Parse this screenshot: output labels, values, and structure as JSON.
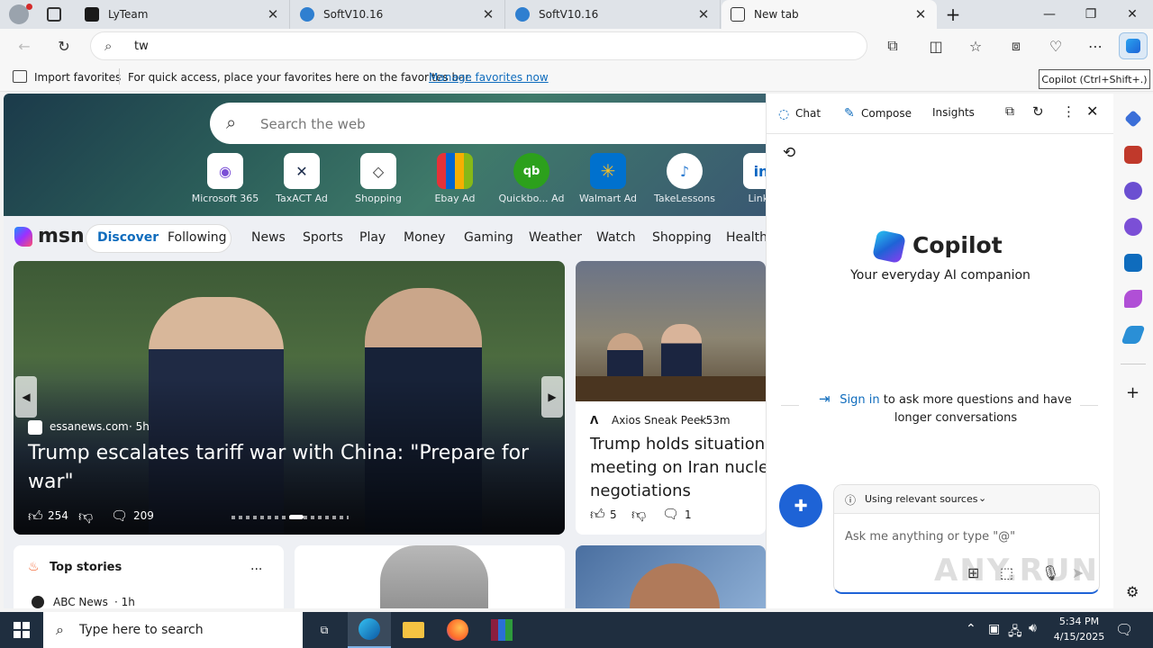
{
  "tabs": [
    {
      "title": "LyTeam"
    },
    {
      "title": "SoftV10.16"
    },
    {
      "title": "SoftV10.16"
    },
    {
      "title": "New tab"
    }
  ],
  "address": {
    "value": "tw"
  },
  "favbar": {
    "import": "Import favorites",
    "message": "For quick access, place your favorites here on the favorites bar.",
    "manage": "Manage favorites now"
  },
  "tooltip": "Copilot (Ctrl+Shift+.)",
  "newtab": {
    "search_placeholder": "Search the web",
    "tiles": [
      {
        "label": "Microsoft 365",
        "ad": ""
      },
      {
        "label": "TaxACT",
        "ad": "Ad"
      },
      {
        "label": "Shopping",
        "ad": ""
      },
      {
        "label": "Ebay",
        "ad": "Ad"
      },
      {
        "label": "Quickbo...",
        "ad": "Ad"
      },
      {
        "label": "Walmart",
        "ad": "Ad"
      },
      {
        "label": "TakeLessons",
        "ad": ""
      },
      {
        "label": "Linke",
        "ad": ""
      }
    ],
    "msn_logo": "msn",
    "nav": [
      "Discover",
      "Following",
      "News",
      "Sports",
      "Play",
      "Money",
      "Gaming",
      "Weather",
      "Watch",
      "Shopping",
      "Health"
    ],
    "main_story": {
      "source": "essanews.com",
      "age": "5h",
      "headline": "Trump escalates tariff war with China: \"Prepare for war\"",
      "likes": "254",
      "comments": "209"
    },
    "side_story": {
      "source": "Axios Sneak Peek",
      "age": "53m",
      "headline": "Trump holds situation meeting on Iran nuclear negotiations",
      "likes": "5",
      "comments": "1"
    },
    "top_stories": {
      "title": "Top stories",
      "more": "...",
      "source": "ABC News",
      "age": "1h"
    }
  },
  "copilot": {
    "tabs": [
      "Chat",
      "Compose",
      "Insights"
    ],
    "brand": "Copilot",
    "tagline": "Your everyday AI companion",
    "signin_link": "Sign in",
    "signin_rest": "to ask more questions and have longer conversations",
    "sources": "Using relevant sources",
    "input_placeholder": "Ask me anything or type \"@\"",
    "watermark": "ANY.RUN"
  },
  "taskbar": {
    "search_placeholder": "Type here to search",
    "time": "5:34 PM",
    "date": "4/15/2025"
  },
  "colors": {
    "accent": "#0f6cbd",
    "taskbar": "#1f2e3f",
    "link": "#0f6cbd"
  }
}
